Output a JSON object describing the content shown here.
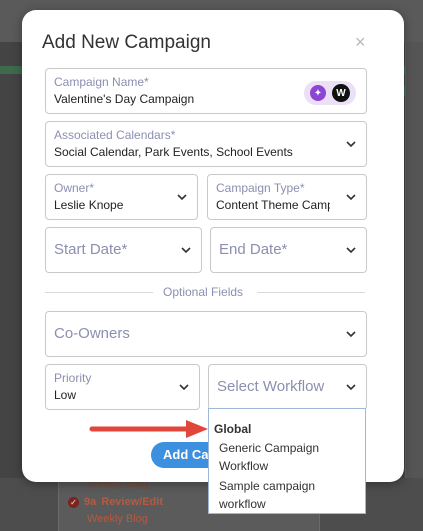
{
  "background": {
    "status_code": "9a",
    "status_label": "Review/Edit",
    "status_sub": "Weekly Blog",
    "partial_text": "Weekly Blog"
  },
  "modal": {
    "title": "Add New Campaign",
    "close_icon": "×",
    "campaign_name": {
      "label": "Campaign Name*",
      "value": "Valentine's Day Campaign",
      "ai_icon": "sparkle-icon",
      "w_icon": "W"
    },
    "associated_calendars": {
      "label": "Associated Calendars*",
      "value": "Social Calendar, Park Events, School Events"
    },
    "owner": {
      "label": "Owner*",
      "value": "Leslie Knope"
    },
    "campaign_type": {
      "label": "Campaign Type*",
      "value": "Content Theme Campai"
    },
    "start_date": {
      "placeholder": "Start Date*"
    },
    "end_date": {
      "placeholder": "End Date*"
    },
    "optional_label": "Optional Fields",
    "co_owners": {
      "placeholder": "Co-Owners"
    },
    "priority": {
      "label": "Priority",
      "value": "Low"
    },
    "workflow": {
      "placeholder": "Select Workflow"
    },
    "add_button": "Add Cam"
  },
  "workflow_dropdown": {
    "group": "Global",
    "options": [
      "Generic Campaign Workflow",
      "Sample campaign workflow"
    ]
  },
  "colors": {
    "accent": "#3d8fe0",
    "label": "#8c8fb0",
    "arrow": "#e0463a"
  }
}
